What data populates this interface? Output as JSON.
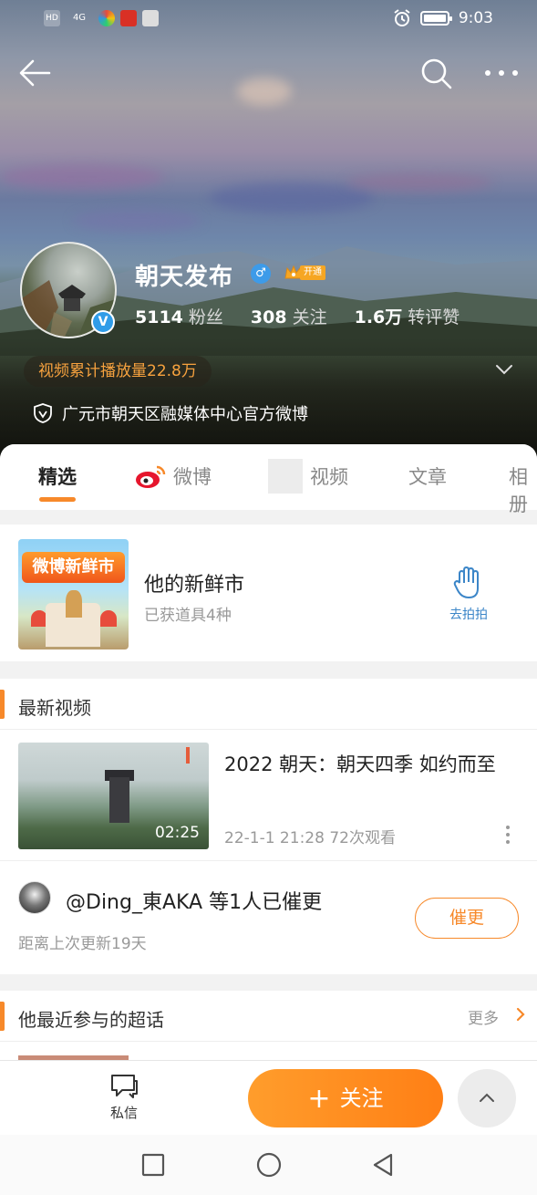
{
  "status_bar": {
    "time": "9:03",
    "network": "4G",
    "hd": "HD"
  },
  "profile": {
    "name": "朝天发布",
    "vip_tag": "开通",
    "stats": [
      {
        "num": "5114",
        "label": "粉丝"
      },
      {
        "num": "308",
        "label": "关注"
      },
      {
        "num": "1.6万",
        "label": "转评赞"
      }
    ],
    "play_count": "视频累计播放量22.8万",
    "official_desc": "广元市朝天区融媒体中心官方微博"
  },
  "tabs": [
    "精选",
    "微博",
    "视频",
    "文章",
    "相册"
  ],
  "promo": {
    "banner_text": "微博新鲜市",
    "title": "他的新鲜市",
    "subtitle": "已获道具4种",
    "action_label": "去拍拍"
  },
  "latest_video": {
    "section_title": "最新视频",
    "duration": "02:25",
    "title": "2022 朝天：朝天四季 如约而至",
    "meta": "22-1-1 21:28 72次观看",
    "urge_text": "@Ding_東AKA 等1人已催更",
    "urge_sub": "距离上次更新19天",
    "urge_button": "催更"
  },
  "super_topic": {
    "section_title": "他最近参与的超话",
    "more_label": "更多"
  },
  "bottom": {
    "dm_label": "私信",
    "follow_label": "关注"
  },
  "colors": {
    "accent": "#f7892a",
    "link_blue": "#3c86c8",
    "verified_blue": "#2f9ce8"
  }
}
